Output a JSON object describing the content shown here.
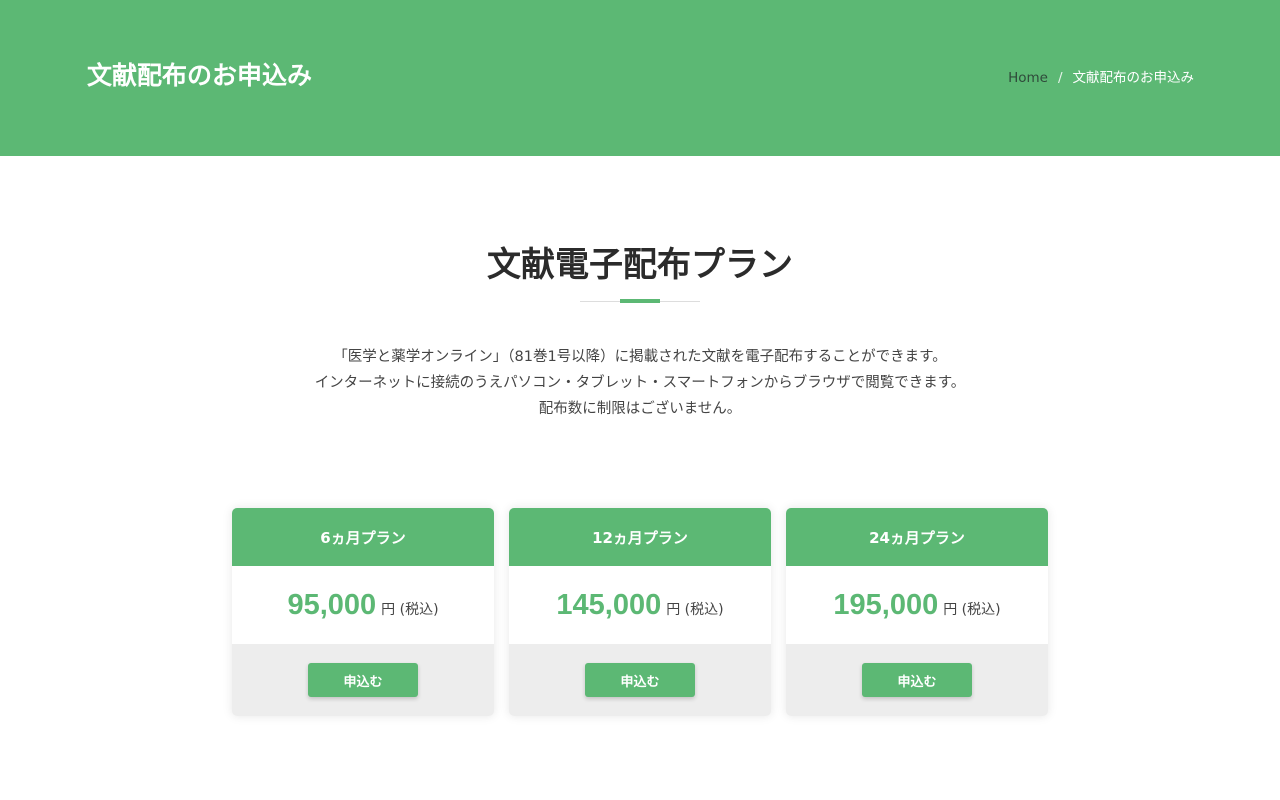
{
  "header": {
    "title": "文献配布のお申込み",
    "breadcrumb": {
      "home": "Home",
      "separator": "/",
      "current": "文献配布のお申込み"
    }
  },
  "section": {
    "title": "文献電子配布プラン",
    "intro": [
      "「医学と薬学オンライン」（81巻1号以降）に掲載された文献を電子配布することができます。",
      "インターネットに接続のうえパソコン・タブレット・スマートフォンからブラウザで閲覧できます。",
      "配布数に制限はございません。"
    ]
  },
  "plans": [
    {
      "name": "6ヵ月プラン",
      "price": "95,000",
      "unit": "円 (税込)",
      "button": "申込む"
    },
    {
      "name": "12ヵ月プラン",
      "price": "145,000",
      "unit": "円 (税込)",
      "button": "申込む"
    },
    {
      "name": "24ヵ月プラン",
      "price": "195,000",
      "unit": "円 (税込)",
      "button": "申込む"
    }
  ],
  "colors": {
    "accent": "#5cb874",
    "footer_bg": "#ededed"
  }
}
